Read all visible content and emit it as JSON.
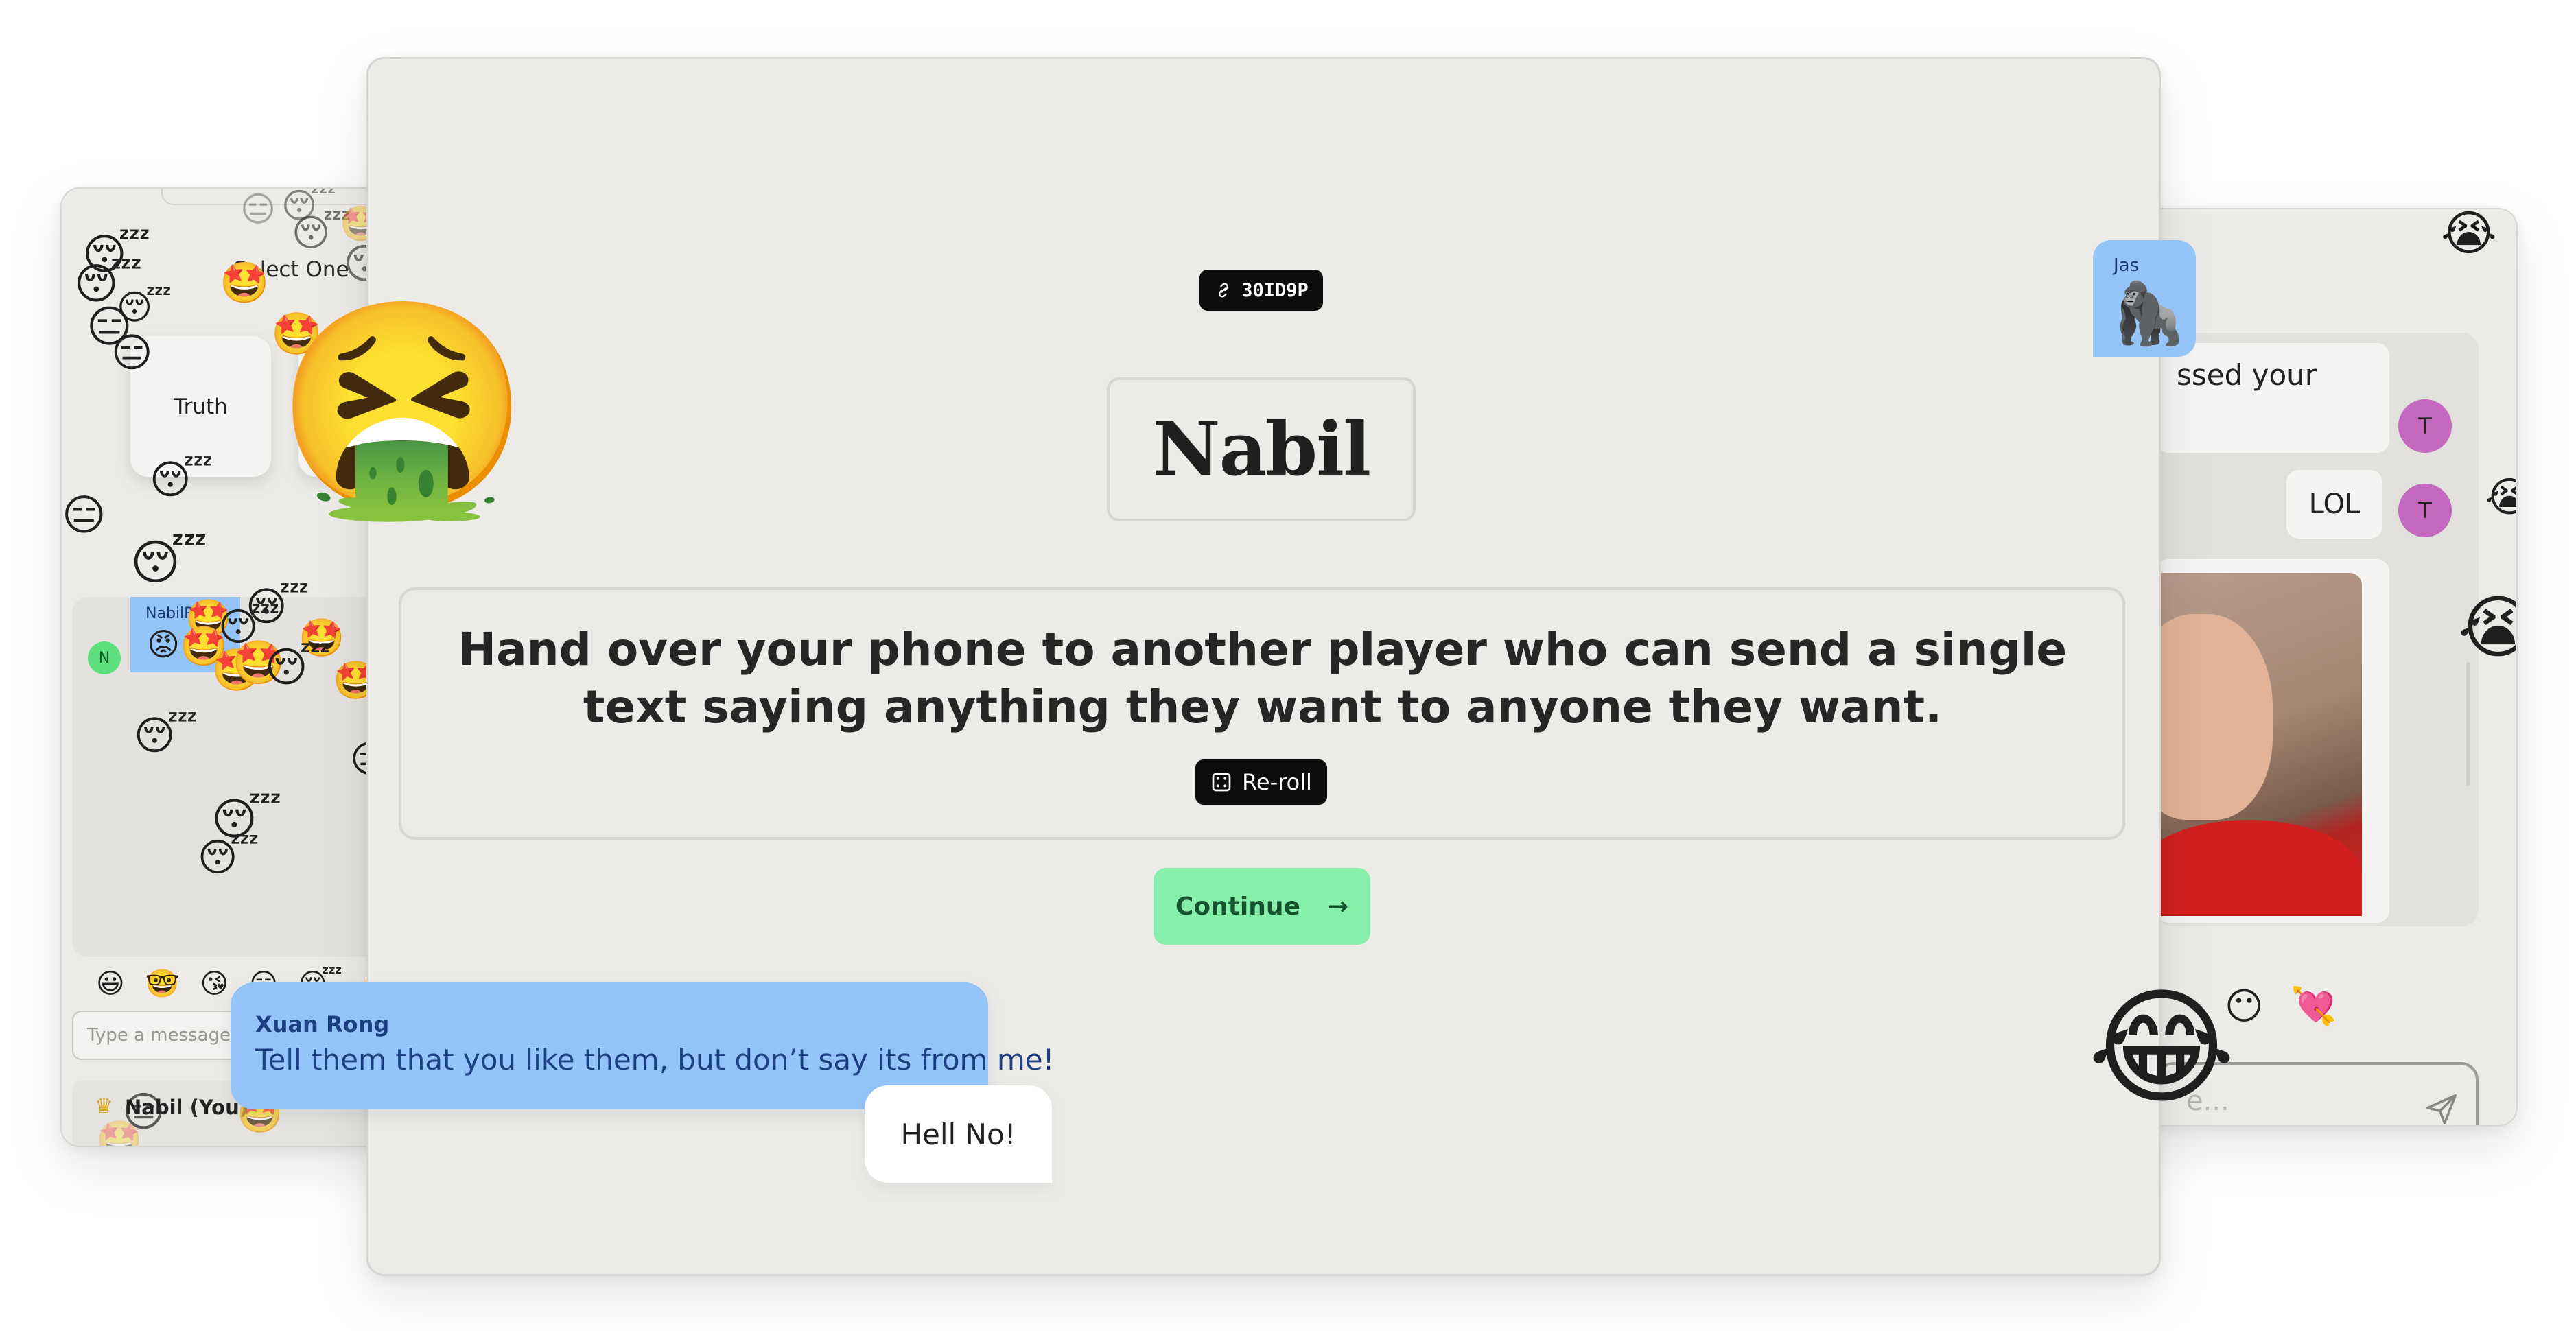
{
  "left_panel": {
    "heading": "Select One",
    "card_truth": "Truth",
    "chat_author": "NabilR",
    "avatar_initial": "N",
    "message_placeholder": "Type a message",
    "player_name": "Nabil (You)",
    "reaction_emojis": [
      "😃",
      "🤓",
      "😘",
      "😑",
      "😴",
      "🤩"
    ]
  },
  "main": {
    "room_code": "30ID9P",
    "player_name": "Nabil",
    "prompt": "Hand over your phone to another player who can send a single text saying anything they want to anyone they want.",
    "reroll_label": "Re-roll",
    "continue_label": "Continue"
  },
  "right_panel": {
    "message_1": "ssed your",
    "message_2": "LOL",
    "avatar_initial": "T",
    "input_placeholder": "e...",
    "reaction_emojis": [
      "😶",
      "💘"
    ]
  },
  "overlays": {
    "chat_xuan": {
      "author": "Xuan Rong",
      "text": "Tell them that you like them, but don’t say its from me!"
    },
    "chat_reply": {
      "text": "Hell No!"
    },
    "chat_jas": {
      "author": "Jas"
    }
  },
  "colors": {
    "page_background": "#ffffff",
    "panel_background": "#edebe8",
    "chat_bubble_blue": "#94c4f8",
    "continue_green": "#86efac",
    "continue_text": "#14532d",
    "badge_black": "#0d0d0d",
    "avatar_purple": "#c469bd",
    "avatar_green": "#5fe07f"
  },
  "icons": {
    "room_code": "link-icon",
    "reroll": "dice-icon",
    "continue": "arrow-right-icon",
    "send": "send-icon",
    "crown": "crown-icon"
  }
}
